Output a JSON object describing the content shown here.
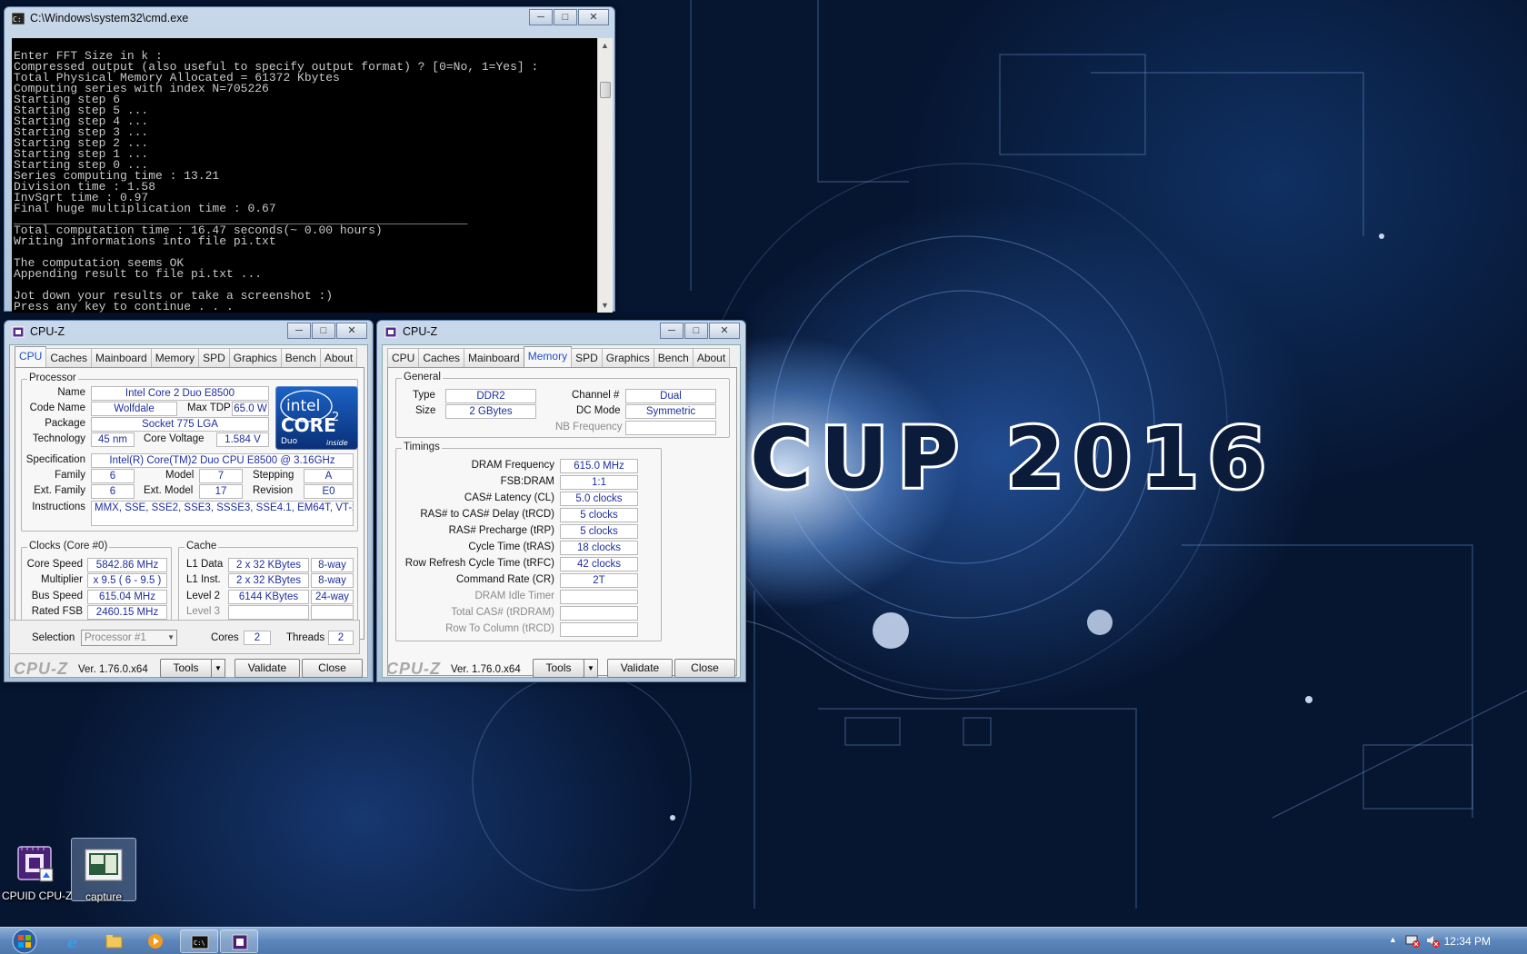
{
  "banner": {
    "text": "CUP 2016"
  },
  "cmd": {
    "title": "C:\\Windows\\system32\\cmd.exe",
    "lines": [
      "Enter FFT Size in k :",
      "Compressed output (also useful to specify output format) ? [0=No, 1=Yes] :",
      "Total Physical Memory Allocated = 61372 Kbytes",
      "Computing series with index N=705226",
      "Starting step 6",
      "Starting step 5 ...",
      "Starting step 4 ...",
      "Starting step 3 ...",
      "Starting step 2 ...",
      "Starting step 1 ...",
      "Starting step 0 ...",
      "Series computing time : 13.21",
      "Division time : 1.58",
      "InvSqrt time : 0.97",
      "Final huge multiplication time : 0.67",
      "________________________________________________________________",
      "Total computation time : 16.47 seconds(~ 0.00 hours)",
      "Writing informations into file pi.txt",
      "",
      "The computation seems OK",
      "Appending result to file pi.txt ...",
      "",
      "Jot down your results or take a screenshot :)",
      "Press any key to continue . . ."
    ]
  },
  "cpuz_common": {
    "title": "CPU-Z",
    "tabs": [
      "CPU",
      "Caches",
      "Mainboard",
      "Memory",
      "SPD",
      "Graphics",
      "Bench",
      "About"
    ],
    "brand": "CPU-Z",
    "version": "Ver. 1.76.0.x64",
    "tools": "Tools",
    "validate": "Validate",
    "close": "Close"
  },
  "cpu_tab": {
    "processor_group": "Processor",
    "name_label": "Name",
    "name": "Intel Core 2 Duo E8500",
    "codename_label": "Code Name",
    "codename": "Wolfdale",
    "maxtdp_label": "Max TDP",
    "maxtdp": "65.0 W",
    "package_label": "Package",
    "package": "Socket 775 LGA",
    "technology_label": "Technology",
    "technology": "45 nm",
    "corevoltage_label": "Core Voltage",
    "corevoltage": "1.584 V",
    "spec_label": "Specification",
    "spec": "Intel(R) Core(TM)2 Duo CPU     E8500  @ 3.16GHz",
    "family_label": "Family",
    "family": "6",
    "model_label": "Model",
    "model": "7",
    "stepping_label": "Stepping",
    "stepping": "A",
    "extfamily_label": "Ext. Family",
    "extfamily": "6",
    "extmodel_label": "Ext. Model",
    "extmodel": "17",
    "revision_label": "Revision",
    "revision": "E0",
    "instructions_label": "Instructions",
    "instructions": "MMX, SSE, SSE2, SSE3, SSSE3, SSE4.1, EM64T, VT-x",
    "intel_logo": {
      "line1": "intel",
      "line2": "CORE",
      "sup": "2",
      "line3": "Duo",
      "line4": "inside"
    },
    "clocks_group": "Clocks (Core #0)",
    "corespeed_label": "Core Speed",
    "corespeed": "5842.86 MHz",
    "multiplier_label": "Multiplier",
    "multiplier": "x 9.5 ( 6 - 9.5 )",
    "busspeed_label": "Bus Speed",
    "busspeed": "615.04 MHz",
    "ratedfsb_label": "Rated FSB",
    "ratedfsb": "2460.15 MHz",
    "cache_group": "Cache",
    "l1data_label": "L1 Data",
    "l1data": "2 x 32 KBytes",
    "l1data_way": "8-way",
    "l1inst_label": "L1 Inst.",
    "l1inst": "2 x 32 KBytes",
    "l1inst_way": "8-way",
    "level2_label": "Level 2",
    "level2": "6144 KBytes",
    "level2_way": "24-way",
    "level3_label": "Level 3",
    "selection_label": "Selection",
    "selection": "Processor #1",
    "cores_label": "Cores",
    "cores": "2",
    "threads_label": "Threads",
    "threads": "2"
  },
  "memory_tab": {
    "general_group": "General",
    "type_label": "Type",
    "type": "DDR2",
    "size_label": "Size",
    "size": "2 GBytes",
    "channel_label": "Channel #",
    "channel": "Dual",
    "dcmode_label": "DC Mode",
    "dcmode": "Symmetric",
    "nbfreq_label": "NB Frequency",
    "timings_group": "Timings",
    "dramfreq_label": "DRAM Frequency",
    "dramfreq": "615.0 MHz",
    "fsbdram_label": "FSB:DRAM",
    "fsbdram": "1:1",
    "cas_label": "CAS# Latency (CL)",
    "cas": "5.0 clocks",
    "trcd_label": "RAS# to CAS# Delay (tRCD)",
    "trcd": "5 clocks",
    "trp_label": "RAS# Precharge (tRP)",
    "trp": "5 clocks",
    "tras_label": "Cycle Time (tRAS)",
    "tras": "18 clocks",
    "trfc_label": "Row Refresh Cycle Time (tRFC)",
    "trfc": "42 clocks",
    "cr_label": "Command Rate (CR)",
    "cr": "2T",
    "idle_label": "DRAM Idle Timer",
    "trdram_label": "Total CAS# (tRDRAM)",
    "trcd2_label": "Row To Column (tRCD)"
  },
  "desktop": {
    "icons": [
      {
        "caption": "CPUID CPU-Z",
        "icon": "cpuz-chip-icon"
      },
      {
        "caption": "capture",
        "icon": "image-file-icon"
      }
    ]
  },
  "taskbar": {
    "clock": "12:34 PM",
    "pinned": [
      "ie-icon",
      "folder-icon",
      "media-player-icon",
      "cmd-icon",
      "cpuz-icon"
    ]
  }
}
